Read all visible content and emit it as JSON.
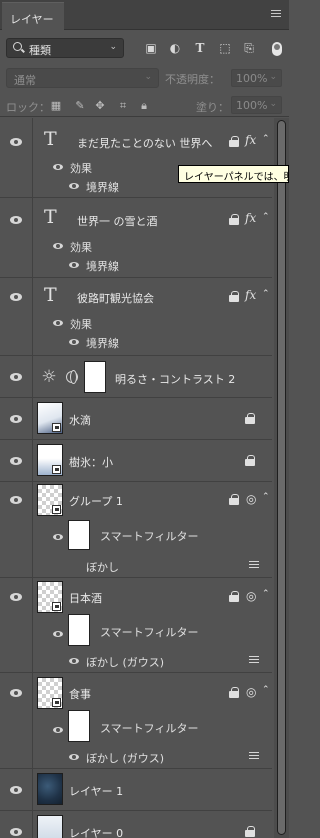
{
  "panel": {
    "tab_label": "レイヤー"
  },
  "filter": {
    "kind_label": "種類"
  },
  "blend": {
    "mode": "通常",
    "opacity_label": "不透明度：",
    "opacity_value": "100%",
    "fill_label": "塗り：",
    "fill_value": "100%"
  },
  "lock": {
    "label": "ロック："
  },
  "tooltip": "レイヤーパネルでは、明",
  "layers": {
    "l1": {
      "name": "まだ見たことのない 世界へ",
      "effects": "効果",
      "stroke": "境界線"
    },
    "l2": {
      "name": "世界一 の雪と酒",
      "effects": "効果",
      "stroke": "境界線"
    },
    "l3": {
      "name": "彼路町観光協会",
      "effects": "効果",
      "stroke": "境界線"
    },
    "l4": {
      "name": "明るさ・コントラスト 2"
    },
    "l5": {
      "name": "水滴"
    },
    "l6": {
      "name": "樹氷：小"
    },
    "l7": {
      "name": "グループ 1",
      "smart": "スマートフィルター",
      "filter": "ぼかし"
    },
    "l8": {
      "name": "日本酒",
      "smart": "スマートフィルター",
      "filter": "ぼかし (ガウス)"
    },
    "l9": {
      "name": "食事",
      "smart": "スマートフィルター",
      "filter": "ぼかし (ガウス)"
    },
    "l10": {
      "name": "レイヤー 1"
    },
    "l11": {
      "name": "レイヤー 0"
    }
  }
}
